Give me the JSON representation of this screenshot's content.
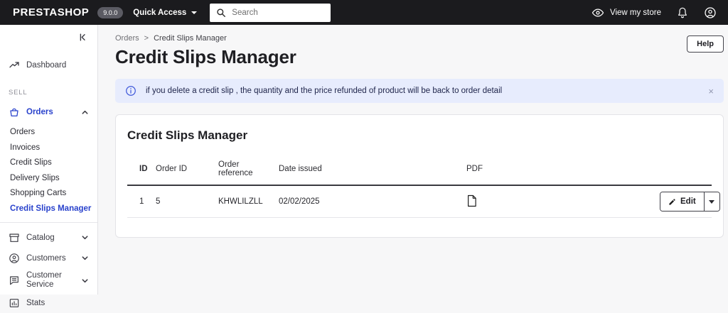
{
  "topbar": {
    "logo": "PRESTASHOP",
    "version": "9.0.0",
    "quick_access": "Quick Access",
    "search_placeholder": "Search",
    "view_my_store": "View my store"
  },
  "sidebar": {
    "dashboard": "Dashboard",
    "section_sell": "SELL",
    "orders": "Orders",
    "sub": [
      "Orders",
      "Invoices",
      "Credit Slips",
      "Delivery Slips",
      "Shopping Carts",
      "Credit Slips Manager"
    ],
    "catalog": "Catalog",
    "customers": "Customers",
    "customer_service": "Customer Service",
    "stats": "Stats"
  },
  "breadcrumb": {
    "parent": "Orders",
    "separator": ">",
    "current": "Credit Slips Manager"
  },
  "page": {
    "title": "Credit Slips Manager",
    "help": "Help"
  },
  "alert": {
    "message": "if you delete a credit slip , the quantity and the price refunded of product will be back to order detail",
    "close": "×"
  },
  "panel": {
    "title": "Credit Slips Manager",
    "table": {
      "headers": {
        "id": "ID",
        "order_id": "Order ID",
        "order_reference": "Order reference",
        "date_issued": "Date issued",
        "pdf": "PDF"
      },
      "row": {
        "id": "1",
        "order_id": "5",
        "order_reference": "KHWLILZLL",
        "date_issued": "02/02/2025"
      },
      "edit": "Edit"
    }
  },
  "colors": {
    "accent": "#2942cc",
    "topbar_bg": "#1b1b1e",
    "alert_bg": "#e7ecfd"
  }
}
